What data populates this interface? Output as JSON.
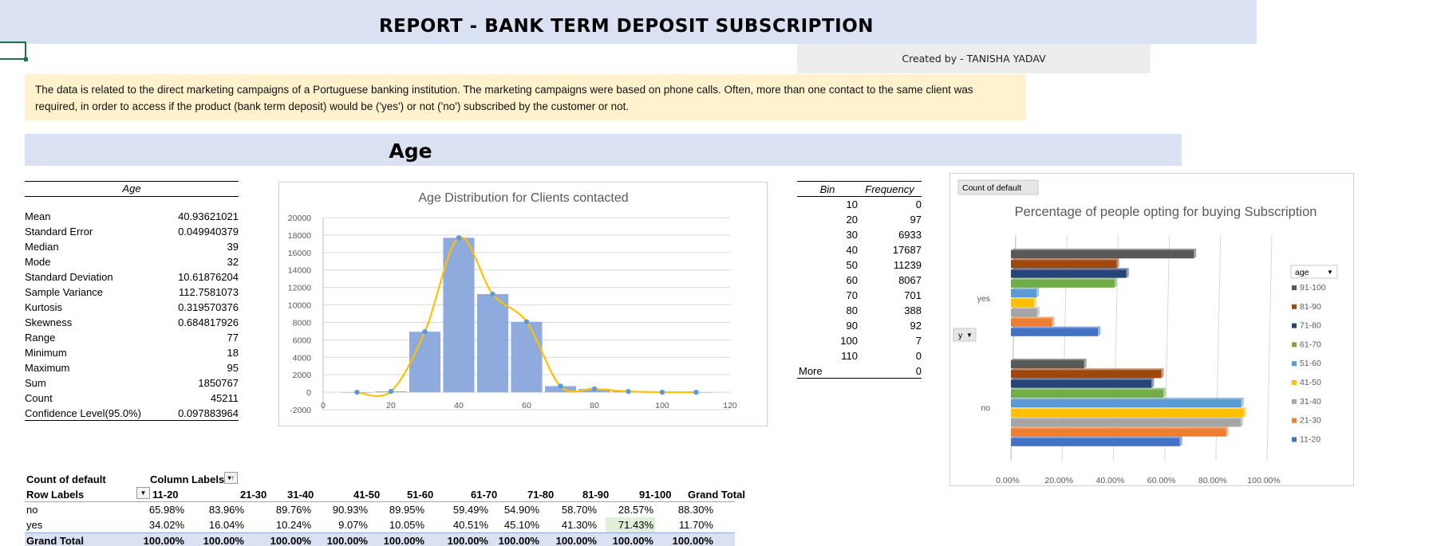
{
  "report": {
    "title": "REPORT - BANK TERM DEPOSIT SUBSCRIPTION",
    "created_by": "Created by - TANISHA YADAV",
    "description": "The data is related to the direct marketing campaigns of a Portuguese banking institution. The marketing campaigns were based on phone calls. Often, more than one contact to the same client was required, in order to access if the product (bank term deposit) would be ('yes') or not ('no') subscribed by the customer or not.",
    "section_heading": "Age"
  },
  "stats": {
    "header": "Age",
    "rows": [
      {
        "label": "Mean",
        "value": "40.93621021"
      },
      {
        "label": "Standard Error",
        "value": "0.049940379"
      },
      {
        "label": "Median",
        "value": "39"
      },
      {
        "label": "Mode",
        "value": "32"
      },
      {
        "label": "Standard Deviation",
        "value": "10.61876204"
      },
      {
        "label": "Sample Variance",
        "value": "112.7581073"
      },
      {
        "label": "Kurtosis",
        "value": "0.319570376"
      },
      {
        "label": "Skewness",
        "value": "0.684817926"
      },
      {
        "label": "Range",
        "value": "77"
      },
      {
        "label": "Minimum",
        "value": "18"
      },
      {
        "label": "Maximum",
        "value": "95"
      },
      {
        "label": "Sum",
        "value": "1850767"
      },
      {
        "label": "Count",
        "value": "45211"
      },
      {
        "label": "Confidence Level(95.0%)",
        "value": "0.097883964"
      }
    ]
  },
  "frequency": {
    "bin_header": "Bin",
    "freq_header": "Frequency",
    "rows": [
      {
        "bin": "10",
        "freq": "0"
      },
      {
        "bin": "20",
        "freq": "97"
      },
      {
        "bin": "30",
        "freq": "6933"
      },
      {
        "bin": "40",
        "freq": "17687"
      },
      {
        "bin": "50",
        "freq": "11239"
      },
      {
        "bin": "60",
        "freq": "8067"
      },
      {
        "bin": "70",
        "freq": "701"
      },
      {
        "bin": "80",
        "freq": "388"
      },
      {
        "bin": "90",
        "freq": "92"
      },
      {
        "bin": "100",
        "freq": "7"
      },
      {
        "bin": "110",
        "freq": "0"
      },
      {
        "bin": "More",
        "freq": "0"
      }
    ]
  },
  "pivot": {
    "value_field": "Count of default",
    "column_labels": "Column Labels",
    "row_labels": "Row Labels",
    "columns": [
      "11-20",
      "21-30",
      "31-40",
      "41-50",
      "51-60",
      "61-70",
      "71-80",
      "81-90",
      "91-100",
      "Grand Total"
    ],
    "rows": [
      {
        "label": "no",
        "values": [
          "65.98%",
          "83.96%",
          "89.76%",
          "90.93%",
          "89.95%",
          "59.49%",
          "54.90%",
          "58.70%",
          "28.57%",
          "88.30%"
        ]
      },
      {
        "label": "yes",
        "values": [
          "34.02%",
          "16.04%",
          "10.24%",
          "9.07%",
          "10.05%",
          "40.51%",
          "45.10%",
          "41.30%",
          "71.43%",
          "11.70%"
        ]
      },
      {
        "label": "Grand Total",
        "values": [
          "100.00%",
          "100.00%",
          "100.00%",
          "100.00%",
          "100.00%",
          "100.00%",
          "100.00%",
          "100.00%",
          "100.00%",
          "100.00%"
        ]
      }
    ]
  },
  "chart_data": [
    {
      "type": "bar",
      "title": "Age Distribution for Clients contacted",
      "categories": [
        10,
        20,
        30,
        40,
        50,
        60,
        70,
        80,
        90,
        100,
        110
      ],
      "values": [
        0,
        97,
        6933,
        17687,
        11239,
        8067,
        701,
        388,
        92,
        7,
        0
      ],
      "smoothed_line": true,
      "xlim": [
        0,
        120
      ],
      "ylim": [
        -2000,
        20000
      ],
      "xticks": [
        "0",
        "20",
        "40",
        "60",
        "80",
        "100",
        "120"
      ],
      "yticks": [
        "20000",
        "18000",
        "16000",
        "14000",
        "12000",
        "10000",
        "8000",
        "6000",
        "4000",
        "2000",
        "0",
        "-2000"
      ],
      "grid": true,
      "colors": {
        "bar": "#8faadc",
        "line": "#ffc000",
        "marker": "#5b9bd5"
      }
    },
    {
      "type": "bar",
      "orientation": "horizontal",
      "title": "Percentage of people opting for buying Subscription",
      "field_button": "Count of default",
      "axis_field_button": "y",
      "legend_title": "age",
      "categories": [
        "yes",
        "no"
      ],
      "xlim": [
        0,
        1
      ],
      "xticks": [
        "0.00%",
        "20.00%",
        "40.00%",
        "60.00%",
        "80.00%",
        "100.00%"
      ],
      "legend_position": "right",
      "series": [
        {
          "name": "91-100",
          "color": "#595959",
          "values": [
            71.43,
            28.57
          ]
        },
        {
          "name": "81-90",
          "color": "#9e480e",
          "values": [
            41.3,
            58.7
          ]
        },
        {
          "name": "71-80",
          "color": "#264478",
          "values": [
            45.1,
            54.9
          ]
        },
        {
          "name": "61-70",
          "color": "#70ad47",
          "values": [
            40.51,
            59.49
          ]
        },
        {
          "name": "51-60",
          "color": "#5b9bd5",
          "values": [
            10.05,
            89.95
          ]
        },
        {
          "name": "41-50",
          "color": "#ffc000",
          "values": [
            9.07,
            90.93
          ]
        },
        {
          "name": "31-40",
          "color": "#a5a5a5",
          "values": [
            10.24,
            89.76
          ]
        },
        {
          "name": "21-30",
          "color": "#ed7d31",
          "values": [
            16.04,
            83.96
          ]
        },
        {
          "name": "11-20",
          "color": "#4472c4",
          "values": [
            34.02,
            65.98
          ]
        }
      ]
    }
  ]
}
